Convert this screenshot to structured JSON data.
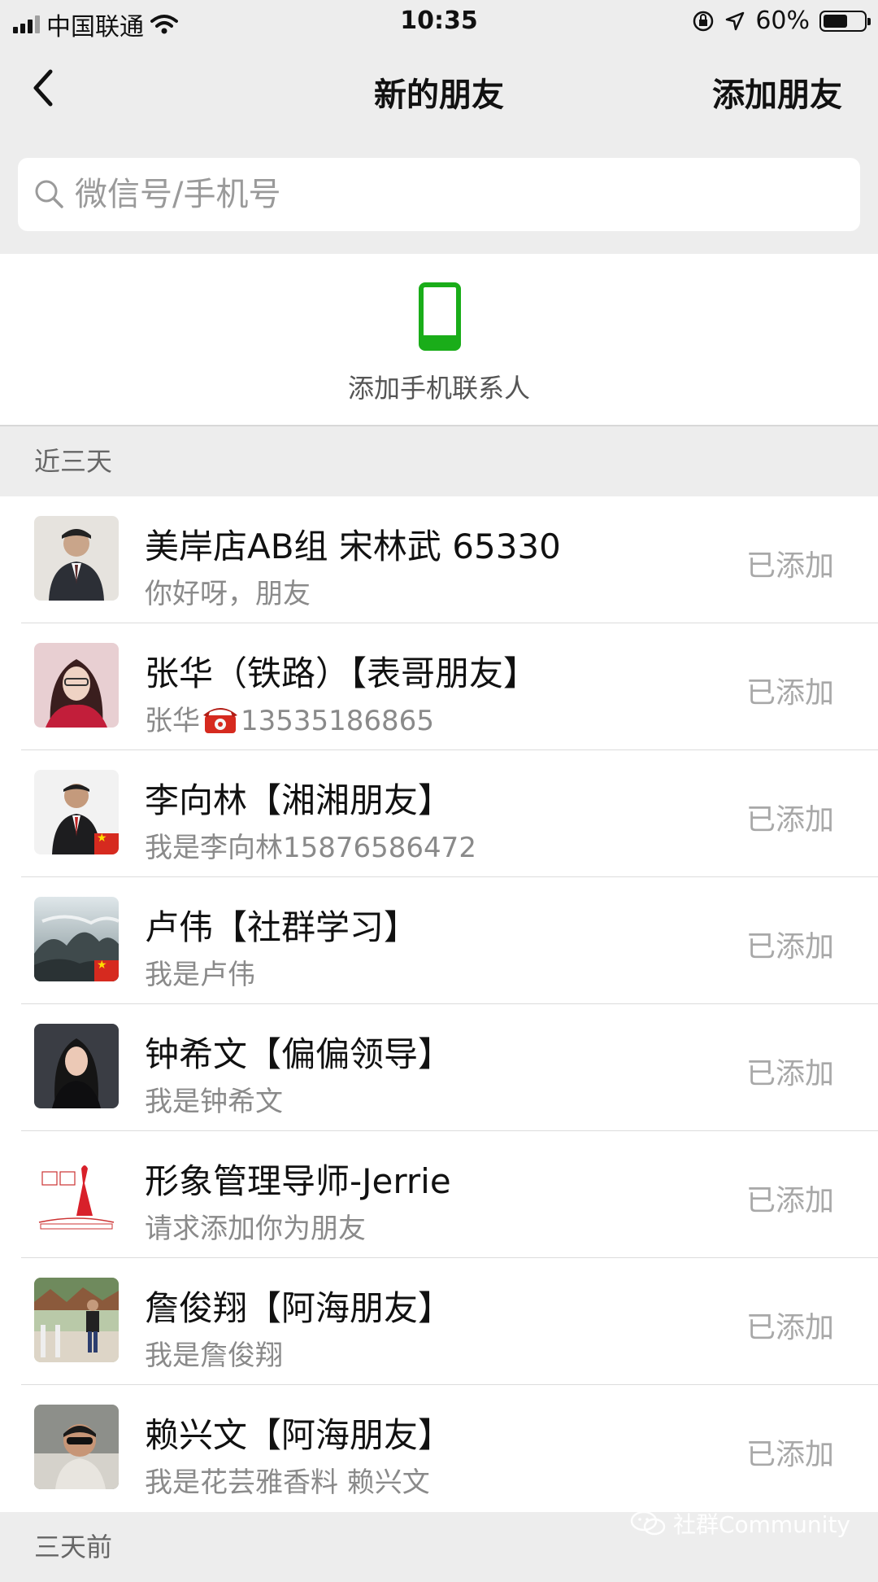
{
  "status_bar": {
    "carrier": "中国联通",
    "time": "10:35",
    "battery_pct": "60%",
    "battery_level": 0.6
  },
  "nav": {
    "title": "新的朋友",
    "action": "添加朋友",
    "back_icon": "chevron-left-icon"
  },
  "search": {
    "placeholder": "微信号/手机号",
    "value": ""
  },
  "add_phone_contacts": {
    "label": "添加手机联系人",
    "icon": "smartphone-icon",
    "icon_color": "#1aad19"
  },
  "sections": {
    "recent": "近三天",
    "earlier": "三天前"
  },
  "friends": [
    {
      "name": "美岸店AB组  宋林武 65330",
      "message": "你好呀，朋友",
      "status": "已添加"
    },
    {
      "name": "张华（铁路）【表哥朋友】",
      "message_prefix": "张华",
      "message_icon": "telephone-icon",
      "message": "13535186865",
      "status": "已添加"
    },
    {
      "name": "李向林【湘湘朋友】",
      "message": "我是李向林15876586472",
      "status": "已添加"
    },
    {
      "name": "卢伟【社群学习】",
      "message": "我是卢伟",
      "status": "已添加"
    },
    {
      "name": "钟希文【偏偏领导】",
      "message": "我是钟希文",
      "status": "已添加"
    },
    {
      "name": "形象管理导师-Jerrie",
      "message": "请求添加你为朋友",
      "status": "已添加"
    },
    {
      "name": "詹俊翔【阿海朋友】",
      "message": "我是詹俊翔",
      "status": "已添加"
    },
    {
      "name": "赖兴文【阿海朋友】",
      "message": "我是花芸雅香料   赖兴文",
      "status": "已添加"
    }
  ],
  "watermark": "社群Community"
}
